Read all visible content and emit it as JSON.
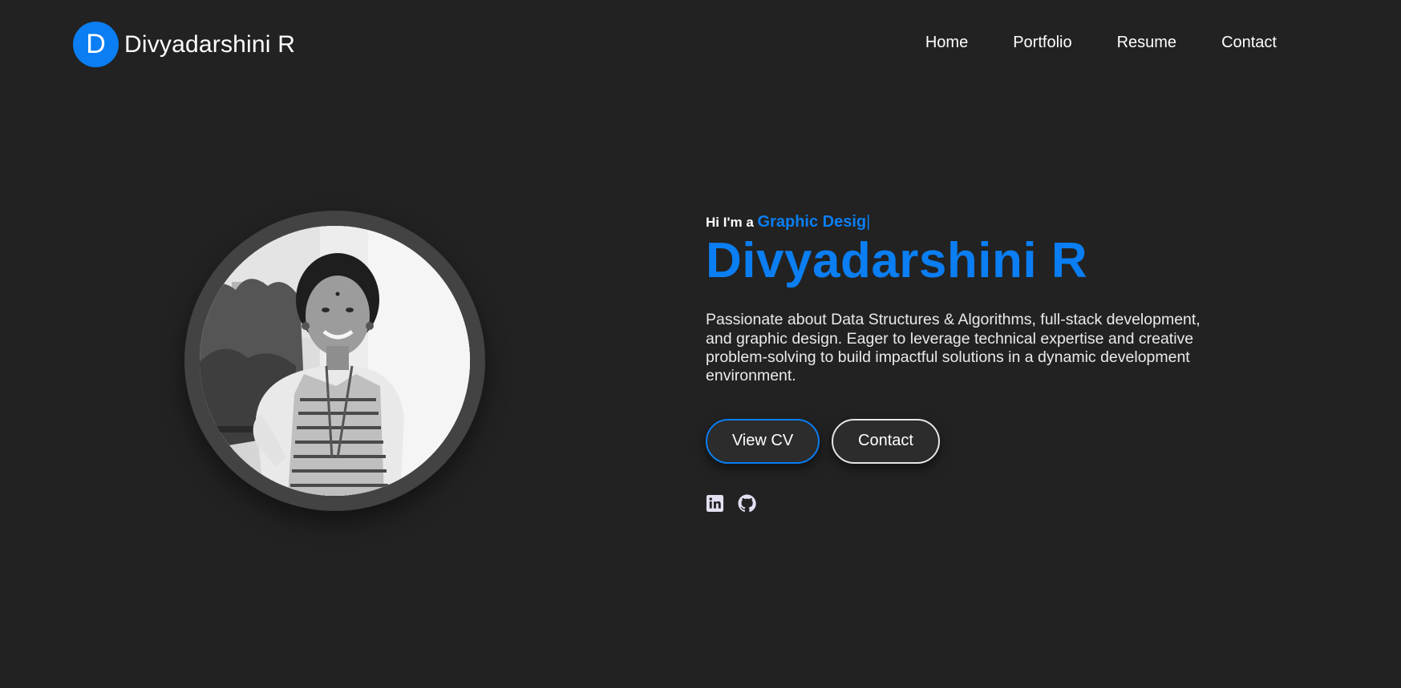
{
  "brand": {
    "initial": "D",
    "name": "Divyadarshini R"
  },
  "nav": {
    "items": [
      {
        "label": "Home"
      },
      {
        "label": "Portfolio"
      },
      {
        "label": "Resume"
      },
      {
        "label": "Contact"
      }
    ]
  },
  "hero": {
    "greeting": "Hi I'm a",
    "typed_role": "Graphic Desig",
    "cursor": "|",
    "name": "Divyadarshini R",
    "description": "Passionate about Data Structures & Algorithms, full-stack development, and graphic design. Eager to leverage technical expertise and creative problem-solving to build impactful solutions in a dynamic development environment.",
    "buttons": {
      "cv_label": "View CV",
      "contact_label": "Contact"
    },
    "socials": [
      {
        "icon": "linkedin-icon"
      },
      {
        "icon": "github-icon"
      }
    ]
  },
  "colors": {
    "background": "#222222",
    "accent": "#0a7ef2",
    "ring": "#434343",
    "button_bg": "#2c2c2c"
  }
}
